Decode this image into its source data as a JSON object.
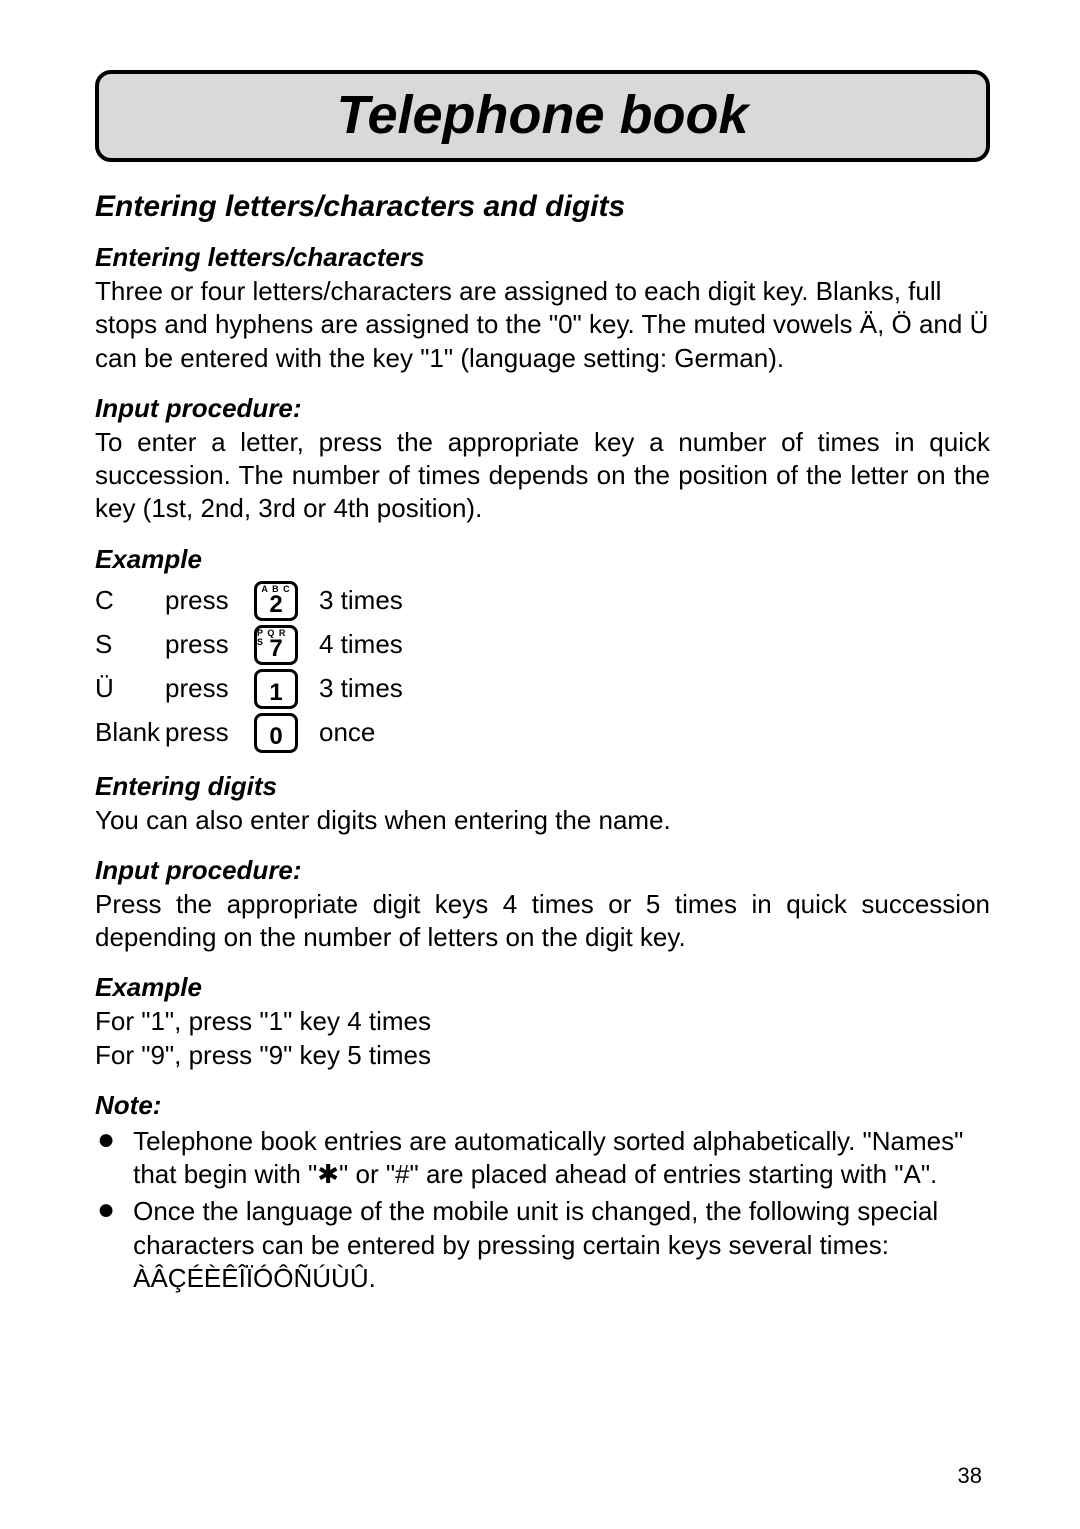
{
  "title": "Telephone book",
  "section_heading": "Entering letters/characters and digits",
  "sub_entering_letters": "Entering letters/characters",
  "para_entering_letters": "Three or four letters/characters are assigned to each digit key. Blanks, full stops and hyphens are assigned to the \"0\" key. The muted vowels Ä, Ö and Ü can be entered with the key \"1\" (language setting: German).",
  "sub_input1": "Input procedure:",
  "para_input1": "To enter a letter, press the appropriate key a number of times in quick succession. The number of times depends on the position of the letter on the key (1st, 2nd, 3rd or 4th position).",
  "sub_example1": "Example",
  "example_rows": [
    {
      "char": "C",
      "action": "press",
      "key_letters": "A B C",
      "key_digit": "2",
      "times": "3 times"
    },
    {
      "char": "S",
      "action": "press",
      "key_letters": "P Q R S",
      "key_digit": "7",
      "times": "4 times"
    },
    {
      "char": "Ü",
      "action": "press",
      "key_letters": "",
      "key_digit": "1",
      "times": "3 times"
    },
    {
      "char": "Blank",
      "action": "press",
      "key_letters": "",
      "key_digit": "0",
      "times": "once"
    }
  ],
  "sub_entering_digits": "Entering digits",
  "para_entering_digits": "You can also enter digits when entering the name.",
  "sub_input2": "Input procedure:",
  "para_input2": "Press the appropriate digit keys 4 times or 5 times in quick succession depending on the number of letters on the digit key.",
  "sub_example2": "Example",
  "example2_line1": "For \"1\", press \"1\" key 4 times",
  "example2_line2": "For \"9\", press \"9\" key 5 times",
  "sub_note": "Note:",
  "notes": [
    "Telephone book entries are automatically sorted alphabetically. \"Names\" that begin with \"✱\" or \"#\" are placed ahead of entries starting with \"A\".",
    "Once the language of the mobile unit is changed, the following special characters can be entered by pressing certain keys several times: ÀÂÇÉÈÊÎÏÓÔÑÚÙÛ."
  ],
  "page_number": "38"
}
